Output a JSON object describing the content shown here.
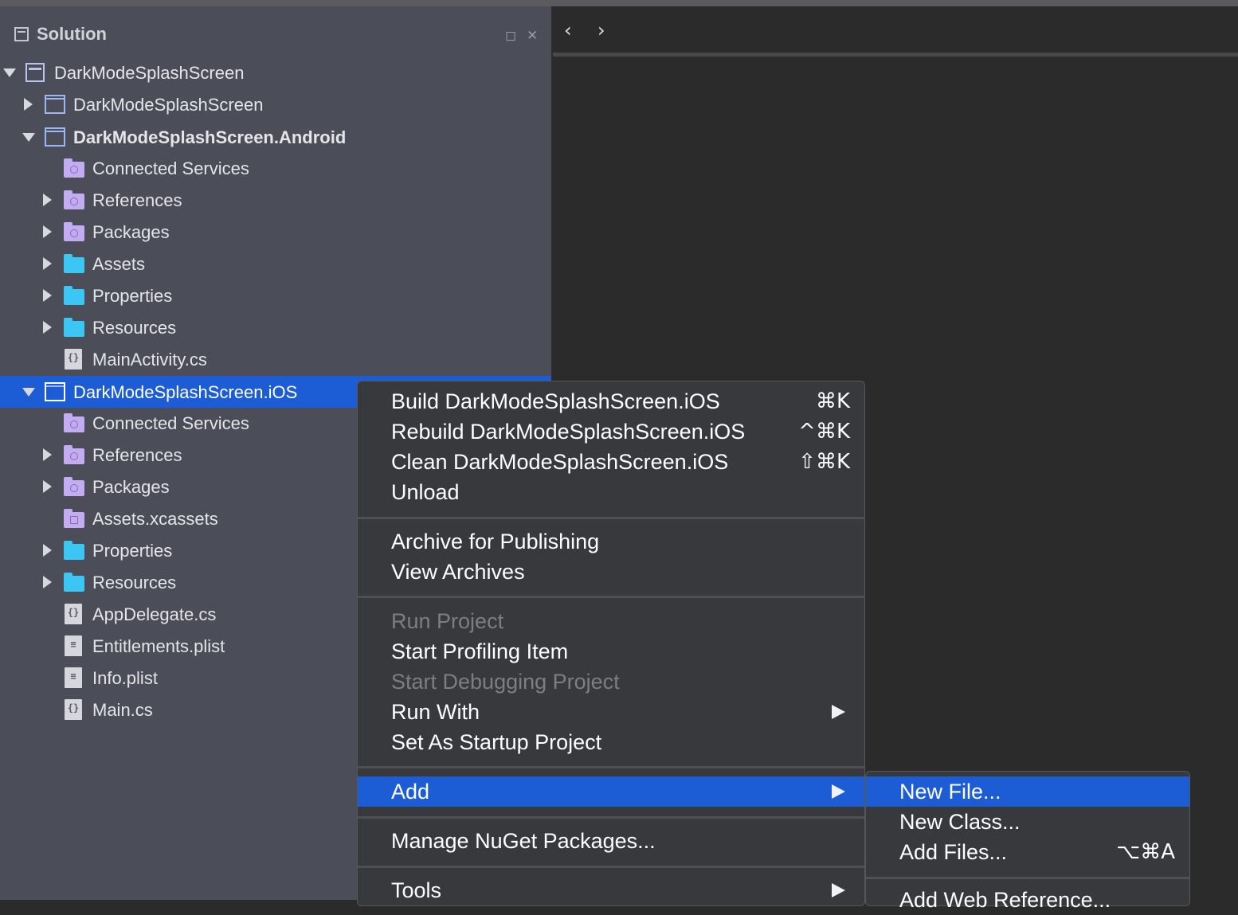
{
  "panel": {
    "title": "Solution",
    "minimize_glyph": "◻",
    "close_glyph": "✕"
  },
  "editor": {
    "back_glyph": "‹",
    "forward_glyph": "›"
  },
  "tree": [
    {
      "label": "DarkModeSplashScreen",
      "icon": "solution-icon",
      "expanded": true
    },
    {
      "label": "DarkModeSplashScreen",
      "icon": "project-icon",
      "expanded": false
    },
    {
      "label": "DarkModeSplashScreen.Android",
      "icon": "project-icon",
      "expanded": true,
      "bold": true
    },
    {
      "label": "Connected Services",
      "icon": "connected-services-folder-icon"
    },
    {
      "label": "References",
      "icon": "references-folder-icon",
      "expanded": false
    },
    {
      "label": "Packages",
      "icon": "packages-folder-icon",
      "expanded": false
    },
    {
      "label": "Assets",
      "icon": "folder-icon",
      "expanded": false
    },
    {
      "label": "Properties",
      "icon": "folder-icon",
      "expanded": false
    },
    {
      "label": "Resources",
      "icon": "folder-icon",
      "expanded": false
    },
    {
      "label": "MainActivity.cs",
      "icon": "csharp-file-icon"
    },
    {
      "label": "DarkModeSplashScreen.iOS",
      "icon": "project-icon",
      "expanded": true,
      "selected": true
    },
    {
      "label": "Connected Services",
      "icon": "connected-services-folder-icon"
    },
    {
      "label": "References",
      "icon": "references-folder-icon",
      "expanded": false
    },
    {
      "label": "Packages",
      "icon": "packages-folder-icon",
      "expanded": false
    },
    {
      "label": "Assets.xcassets",
      "icon": "asset-catalog-icon"
    },
    {
      "label": "Properties",
      "icon": "folder-icon",
      "expanded": false
    },
    {
      "label": "Resources",
      "icon": "folder-icon",
      "expanded": false
    },
    {
      "label": "AppDelegate.cs",
      "icon": "csharp-file-icon"
    },
    {
      "label": "Entitlements.plist",
      "icon": "plist-file-icon"
    },
    {
      "label": "Info.plist",
      "icon": "plist-file-icon"
    },
    {
      "label": "Main.cs",
      "icon": "csharp-file-icon"
    }
  ],
  "context_menu": {
    "items": [
      {
        "label": "Build DarkModeSplashScreen.iOS",
        "shortcut": "⌘K"
      },
      {
        "label": "Rebuild DarkModeSplashScreen.iOS",
        "shortcut": "^⌘K"
      },
      {
        "label": "Clean DarkModeSplashScreen.iOS",
        "shortcut": "⇧⌘K"
      },
      {
        "label": "Unload"
      },
      {
        "label": "Archive for Publishing"
      },
      {
        "label": "View Archives"
      },
      {
        "label": "Run Project",
        "disabled": true
      },
      {
        "label": "Start Profiling Item"
      },
      {
        "label": "Start Debugging Project",
        "disabled": true
      },
      {
        "label": "Run With",
        "submenu": true
      },
      {
        "label": "Set As Startup Project"
      },
      {
        "label": "Add",
        "submenu": true,
        "highlighted": true
      },
      {
        "label": "Manage NuGet Packages..."
      },
      {
        "label": "Tools",
        "submenu": true
      }
    ]
  },
  "add_submenu": {
    "items": [
      {
        "label": "New File...",
        "highlighted": true
      },
      {
        "label": "New Class..."
      },
      {
        "label": "Add Files...",
        "shortcut": "⌥⌘A"
      },
      {
        "label": "Add Web Reference..."
      }
    ]
  },
  "colors": {
    "selection": "#1c5dd5",
    "panel_bg": "#4b4e58",
    "menu_bg": "#38393c",
    "editor_bg": "#2b2b2c"
  }
}
